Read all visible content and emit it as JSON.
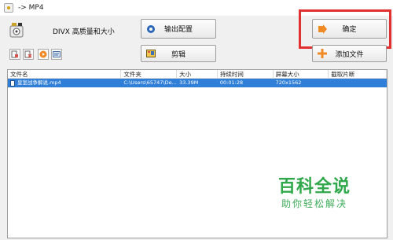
{
  "window": {
    "title": "-> MP4"
  },
  "format": {
    "label": "DIVX 高质量和大小"
  },
  "buttons": {
    "output_config": "输出配置",
    "clip": "剪辑",
    "ok": "确定",
    "add_file": "添加文件"
  },
  "toolbar": {
    "icons": [
      "add-file-icon",
      "remove-file-icon",
      "play-icon",
      "info-icon"
    ]
  },
  "table": {
    "columns": [
      "文件名",
      "文件夹",
      "大小",
      "持续时间",
      "屏幕大小",
      "截取片断"
    ],
    "rows": [
      {
        "name": "皇室战争解说.mp4",
        "folder": "C:\\Users\\65747\\De...",
        "size": "33.39M",
        "duration": "00:01:28",
        "screen": "720x1562",
        "clip": ""
      }
    ]
  },
  "watermark": {
    "title": "百科全说",
    "subtitle": "助你轻松解决"
  },
  "colors": {
    "selection": "#2f7fd8",
    "highlight_frame": "#e0302f",
    "watermark": "#2ea84a",
    "window_bg": "#f0f0f0"
  }
}
